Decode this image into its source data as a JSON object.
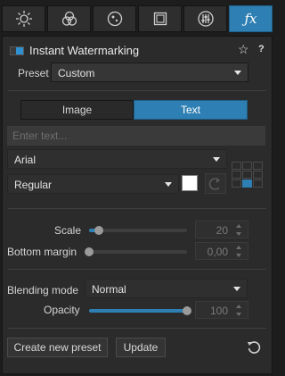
{
  "tabs": [
    {
      "icon": "sun-icon"
    },
    {
      "icon": "color-circles-icon"
    },
    {
      "icon": "vignette-circle-icon"
    },
    {
      "icon": "layers-frame-icon"
    },
    {
      "icon": "sliders-icon"
    },
    {
      "icon": "fx-icon",
      "label": "ƒx",
      "active": true
    }
  ],
  "header": {
    "title": "Instant Watermarking",
    "star": "☆",
    "help": "?"
  },
  "preset": {
    "label": "Preset",
    "value": "Custom"
  },
  "mode_toggle": {
    "image_label": "Image",
    "text_label": "Text",
    "active": "Text"
  },
  "text_input": {
    "placeholder": "Enter text..."
  },
  "font": {
    "family": "Arial",
    "style": "Regular",
    "color": "#ffffff"
  },
  "scale": {
    "label": "Scale",
    "value": "20",
    "level": 0.1
  },
  "bottom_margin": {
    "label": "Bottom margin",
    "value": "0,00",
    "level": 0.0
  },
  "blending": {
    "label": "Blending mode",
    "value": "Normal"
  },
  "opacity": {
    "label": "Opacity",
    "value": "100",
    "level": 1.0
  },
  "footer": {
    "create_label": "Create new preset",
    "update_label": "Update"
  },
  "colors": {
    "accent": "#2e7fb3",
    "panel": "#2b2b2b",
    "background": "#1d1d1d"
  }
}
